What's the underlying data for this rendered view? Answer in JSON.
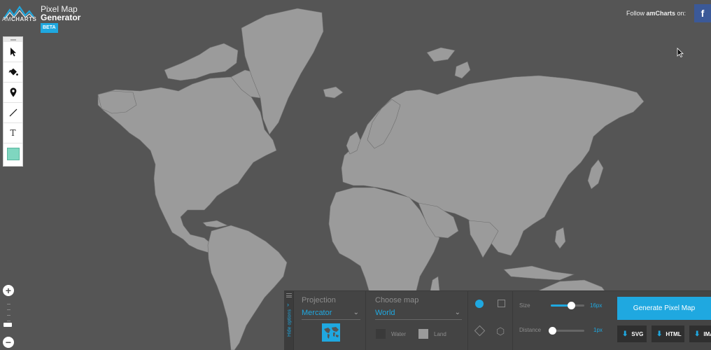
{
  "header": {
    "logo_text_light": "AM",
    "logo_text_bold": "CHARTS",
    "title_line1": "Pixel Map",
    "title_line2": "Generator",
    "badge": "BETA",
    "follow_prefix": "Follow ",
    "follow_brand": "amCharts",
    "follow_suffix": " on:",
    "facebook_glyph": "f"
  },
  "toolbox": {
    "tools": [
      {
        "name": "select-tool",
        "icon": "arrow-pointer-icon"
      },
      {
        "name": "paint-tool",
        "icon": "paint-bucket-icon"
      },
      {
        "name": "marker-tool",
        "icon": "map-pin-icon"
      },
      {
        "name": "line-tool",
        "icon": "line-icon"
      },
      {
        "name": "text-tool",
        "icon": "text-icon",
        "glyph": "T"
      },
      {
        "name": "color-tool",
        "icon": "color-swatch-icon",
        "color": "#7fd6c0"
      }
    ]
  },
  "zoom": {
    "in_label": "+",
    "out_label": "−"
  },
  "panel": {
    "hide_label": "Hide options",
    "projection": {
      "label": "Projection",
      "value": "Mercator"
    },
    "choose_map": {
      "label": "Choose map",
      "value": "World"
    },
    "water_label": "Water",
    "land_label": "Land",
    "water_color": "#3a3a3a",
    "land_color": "#9b9b9b",
    "size": {
      "label": "Size",
      "value": "16px",
      "level": 0.6
    },
    "distance": {
      "label": "Distance",
      "value": "1px",
      "level": 0.05
    },
    "generate_label": "Generate Pixel Map",
    "downloads": [
      "SVG",
      "HTML",
      "IMAGE"
    ]
  },
  "colors": {
    "accent": "#1fa8e0",
    "background": "#555555",
    "land": "#9b9b9b"
  }
}
